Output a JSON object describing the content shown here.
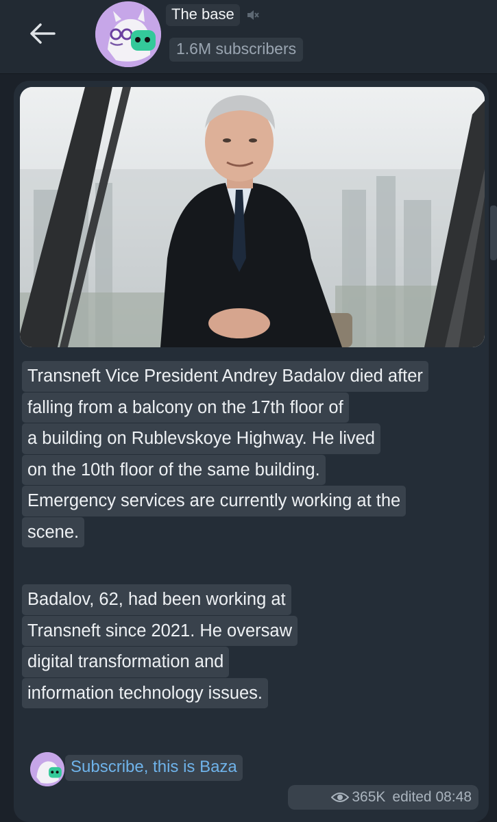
{
  "header": {
    "back_icon": "arrow-left-icon",
    "avatar_icon": "channel-avatar-icon",
    "mute_icon": "muted-speaker-icon",
    "channel_name": "The base",
    "subscribers": "1.6M subscribers"
  },
  "message": {
    "photo_icon": "post-photo",
    "paragraph1_lines": [
      "Transneft Vice President Andrey Badalov died after",
      "falling from a balcony on the 17th floor of",
      "a building on Rublevskoye Highway. He lived",
      "on the 10th floor of the same building.",
      "Emergency services are currently working at the",
      "scene."
    ],
    "paragraph2_lines": [
      "Badalov, 62, had been working at",
      "Transneft since 2021. He oversaw",
      "digital transformation and",
      "information technology issues."
    ],
    "footer": {
      "subscribe_text": "Subscribe, this is Baza",
      "views_icon": "eye-icon",
      "views": "365K",
      "edited": "edited 08:48"
    }
  },
  "colors": {
    "background": "#1b2129",
    "header": "#222a33",
    "bubble": "#242d37",
    "link": "#6fb3ea",
    "chip": "#39424c"
  }
}
